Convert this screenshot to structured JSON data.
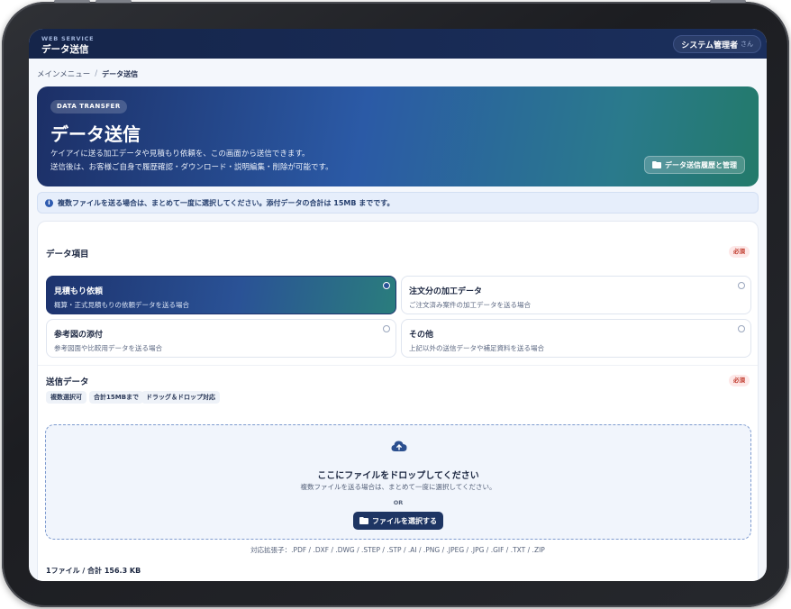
{
  "header": {
    "brand_sub": "WEB SERVICE",
    "brand_title": "データ送信",
    "user_name": "システム管理者",
    "user_suffix": "さん"
  },
  "breadcrumb": {
    "home": "メインメニュー",
    "separator": "/",
    "current": "データ送信"
  },
  "hero": {
    "badge": "DATA TRANSFER",
    "title": "データ送信",
    "desc_line1": "ケイアイに送る加工データや見積もり依頼を、この画面から送信できます。",
    "desc_line2": "送信後は、お客様ご自身で履歴確認・ダウンロード・説明編集・削除が可能です。",
    "history_button": "データ送信履歴と管理"
  },
  "info": {
    "text": "複数ファイルを送る場合は、まとめて一度に選択してください。添付データの合計は 15MB までです。"
  },
  "data_item": {
    "title": "データ項目",
    "required": "必須",
    "options": [
      {
        "title": "見積もり依頼",
        "desc": "概算・正式見積もりの依頼データを送る場合",
        "selected": true
      },
      {
        "title": "注文分の加工データ",
        "desc": "ご注文済み案件の加工データを送る場合",
        "selected": false
      },
      {
        "title": "参考図の添付",
        "desc": "参考図面や比較用データを送る場合",
        "selected": false
      },
      {
        "title": "その他",
        "desc": "上記以外の送信データや補足資料を送る場合",
        "selected": false
      }
    ]
  },
  "send_data": {
    "title": "送信データ",
    "required": "必須",
    "tags": [
      "複数選択可",
      "合計15MBまで",
      "ドラッグ＆ドロップ対応"
    ],
    "drop_title": "ここにファイルをドロップしてください",
    "drop_sub": "複数ファイルを送る場合は、まとめて一度に選択してください。",
    "or": "OR",
    "select_button": "ファイルを選択する",
    "extensions": "対応拡張子：.PDF / .DXF / .DWG / .STEP / .STP / .AI / .PNG / .JPEG / .JPG / .GIF / .TXT / .ZIP",
    "file_count": "1ファイル / 合計 156.3 KB"
  },
  "colors": {
    "topbar": "#15254a",
    "accent": "#1e3563",
    "required": "#c0392b"
  }
}
